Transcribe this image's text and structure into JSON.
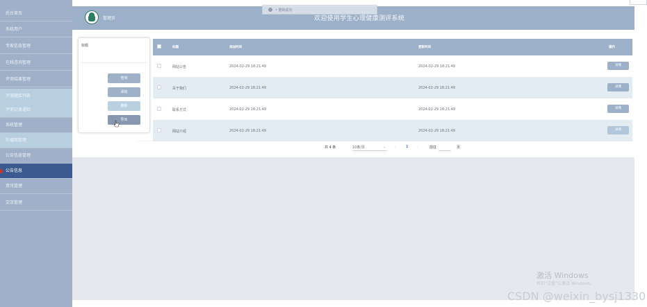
{
  "sidebar": {
    "items": [
      {
        "label": "后台首页"
      },
      {
        "label": "系统用户"
      },
      {
        "label": "专家信息管理"
      },
      {
        "label": "在线咨询管理"
      },
      {
        "label": "评测结果管理"
      },
      {
        "label": "评测题库列表"
      },
      {
        "label": "评测记录通知"
      },
      {
        "label": "系统管理"
      },
      {
        "label": "轮播图管理"
      },
      {
        "label": "公告信息管理"
      },
      {
        "label": "公告信息"
      },
      {
        "label": "资讯管理"
      },
      {
        "label": "交流管理"
      }
    ]
  },
  "header": {
    "admin_name": "管理员",
    "title": "欢迎使用学生心理健康测评系统"
  },
  "toast": {
    "text": "• 删除成功"
  },
  "search": {
    "label": "标题",
    "query_button": "查询",
    "add_button": "添加",
    "delete_button": "删除",
    "export_button": "导出"
  },
  "table": {
    "columns": [
      "标题",
      "添加时间",
      "更新时间",
      "操作"
    ],
    "rows": [
      {
        "title": "网站公告",
        "created": "2024-02-29 18:21:49",
        "updated": "2024-02-29 18:21:49",
        "action": "详情"
      },
      {
        "title": "关于我们",
        "created": "2024-02-29 18:21:49",
        "updated": "2024-02-29 18:21:49",
        "action": "详情"
      },
      {
        "title": "联系方式",
        "created": "2024-02-29 18:21:49",
        "updated": "2024-02-29 18:21:49",
        "action": "详情"
      },
      {
        "title": "网站介绍",
        "created": "2024-02-29 18:21:49",
        "updated": "2024-02-29 18:21:49",
        "action": "详情"
      }
    ]
  },
  "pagination": {
    "total": "共 4 条",
    "page_size": "10条/页",
    "current_page": "1",
    "goto_label": "前往",
    "page_suffix": "页"
  },
  "watermark": {
    "title": "激活 Windows",
    "subtitle": "转到“设置”以激活 Windows。"
  },
  "csdn": "CSDN @weixin_bysj1330"
}
